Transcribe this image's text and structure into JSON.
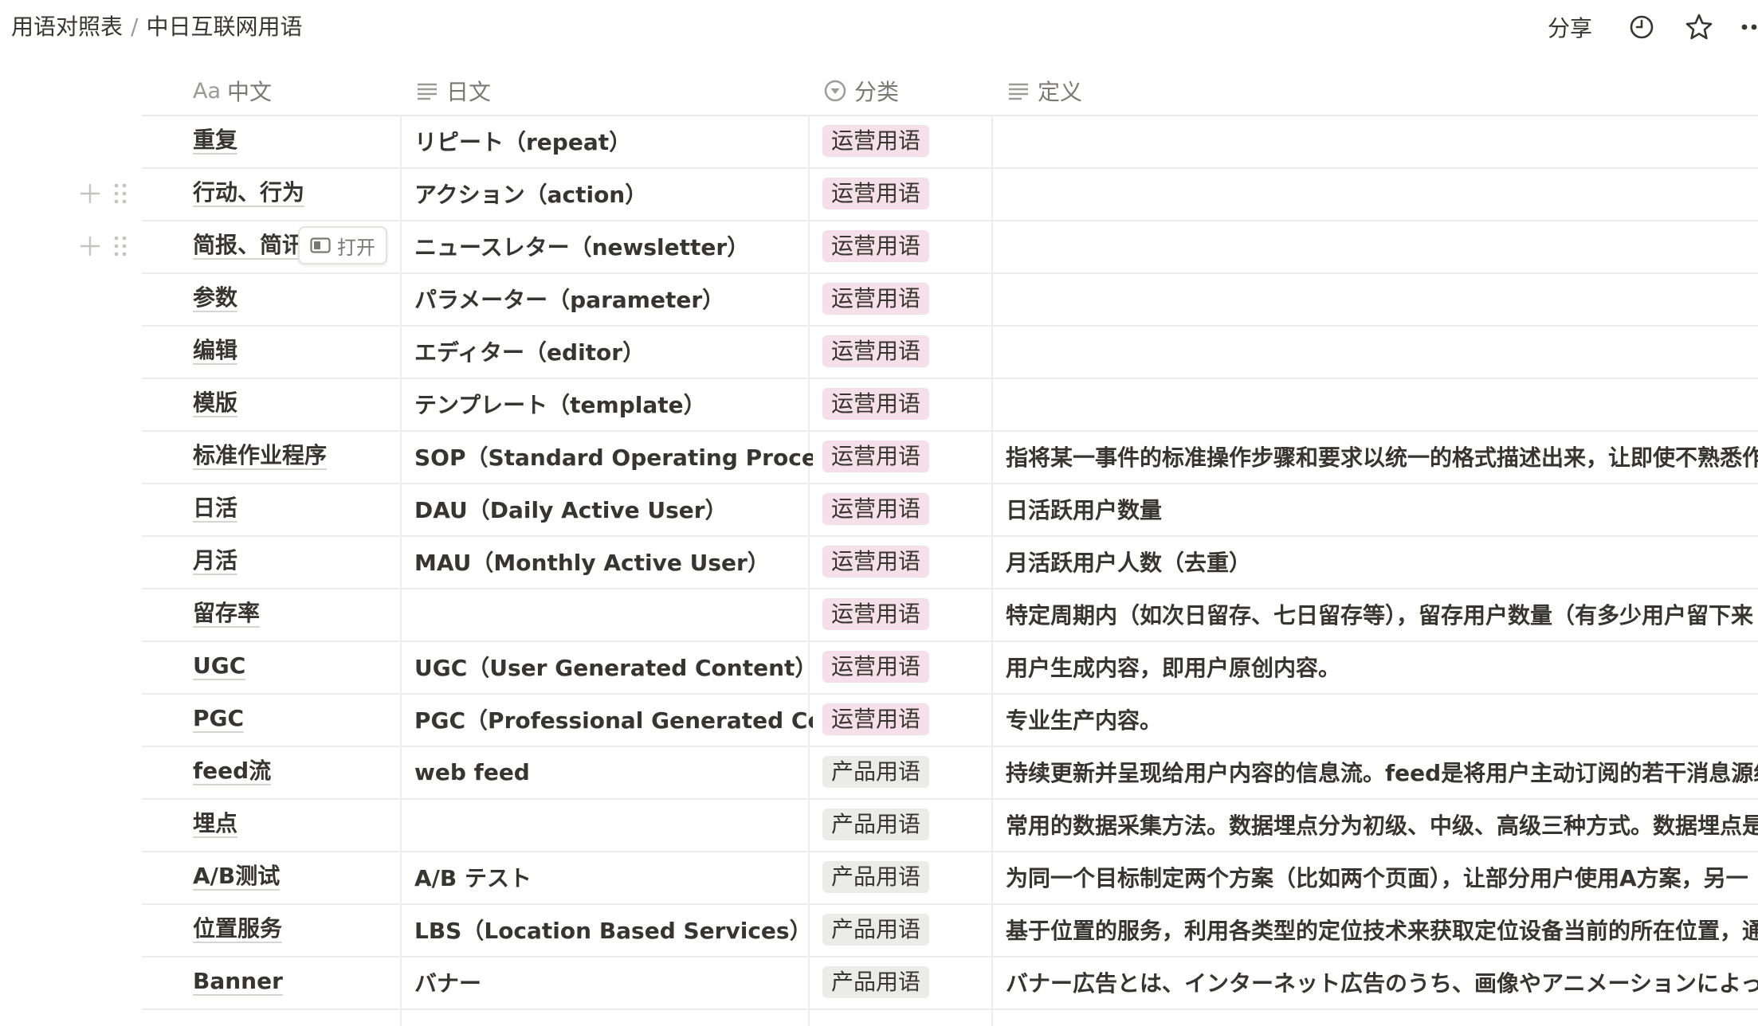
{
  "breadcrumb": {
    "parent": "用语对照表",
    "separator": "/",
    "current": "中日互联网用语"
  },
  "topbar": {
    "share_label": "分享",
    "icons": [
      "history-icon",
      "star-icon",
      "more-icon"
    ]
  },
  "table": {
    "columns": [
      {
        "prefix": "Aa",
        "label": "中文",
        "icon": "title-icon"
      },
      {
        "label": "日文",
        "icon": "text-lines-icon"
      },
      {
        "label": "分类",
        "icon": "select-icon"
      },
      {
        "label": "定义",
        "icon": "text-lines-icon"
      }
    ],
    "hover_open_label": "打开",
    "rows": [
      {
        "zh": "重复",
        "ja": "リピート（repeat）",
        "category": "运营用语",
        "definition": ""
      },
      {
        "zh": "行动、行为",
        "ja": "アクション（action）",
        "category": "运营用语",
        "definition": ""
      },
      {
        "zh": "简报、简讯",
        "ja": "ニュースレター（newsletter）",
        "category": "运营用语",
        "definition": ""
      },
      {
        "zh": "参数",
        "ja": "パラメーター（parameter）",
        "category": "运营用语",
        "definition": ""
      },
      {
        "zh": "编辑",
        "ja": "エディター（editor）",
        "category": "运营用语",
        "definition": ""
      },
      {
        "zh": "模版",
        "ja": "テンプレート（template）",
        "category": "运营用语",
        "definition": ""
      },
      {
        "zh": "标准作业程序",
        "ja": "SOP（Standard Operating Procedure",
        "category": "运营用语",
        "definition": "指将某一事件的标准操作步骤和要求以统一的格式描述出来，让即使不熟悉作"
      },
      {
        "zh": "日活",
        "ja": "DAU（Daily Active User）",
        "category": "运营用语",
        "definition": "日活跃用户数量"
      },
      {
        "zh": "月活",
        "ja": "MAU（Monthly Active User）",
        "category": "运营用语",
        "definition": "月活跃用户人数（去重）"
      },
      {
        "zh": "留存率",
        "ja": "",
        "category": "运营用语",
        "definition": "特定周期内（如次日留存、七日留存等），留存用户数量（有多少用户留下来"
      },
      {
        "zh": "UGC",
        "ja": "UGC（User Generated Content）",
        "category": "运营用语",
        "definition": "用户生成内容，即用户原创内容。"
      },
      {
        "zh": "PGC",
        "ja": "PGC（Professional Generated Conten",
        "category": "运营用语",
        "definition": "专业生产内容。"
      },
      {
        "zh": "feed流",
        "ja": "web feed",
        "category": "产品用语",
        "definition": "持续更新并呈现给用户内容的信息流。feed是将用户主动订阅的若干消息源组"
      },
      {
        "zh": "埋点",
        "ja": "",
        "category": "产品用语",
        "definition": "常用的数据采集方法。数据埋点分为初级、中级、高级三种方式。数据埋点是"
      },
      {
        "zh": "A/B测试",
        "ja": "A/B テスト",
        "category": "产品用语",
        "definition": "为同一个目标制定两个方案（比如两个页面），让部分用户使用A方案，另一"
      },
      {
        "zh": "位置服务",
        "ja": "LBS（Location Based Services）",
        "category": "产品用语",
        "definition": "基于位置的服务，利用各类型的定位技术来获取定位设备当前的所在位置，通"
      },
      {
        "zh": "Banner",
        "ja": "バナー",
        "category": "产品用语",
        "definition": "バナー広告とは、インターネット広告のうち、画像やアニメーションによっ"
      }
    ]
  },
  "colors": {
    "tag_operation_bg": "#f5e0e9",
    "tag_product_bg": "#ebebea",
    "text": "#37352f",
    "muted": "#9b9a97",
    "border": "#ececea"
  }
}
